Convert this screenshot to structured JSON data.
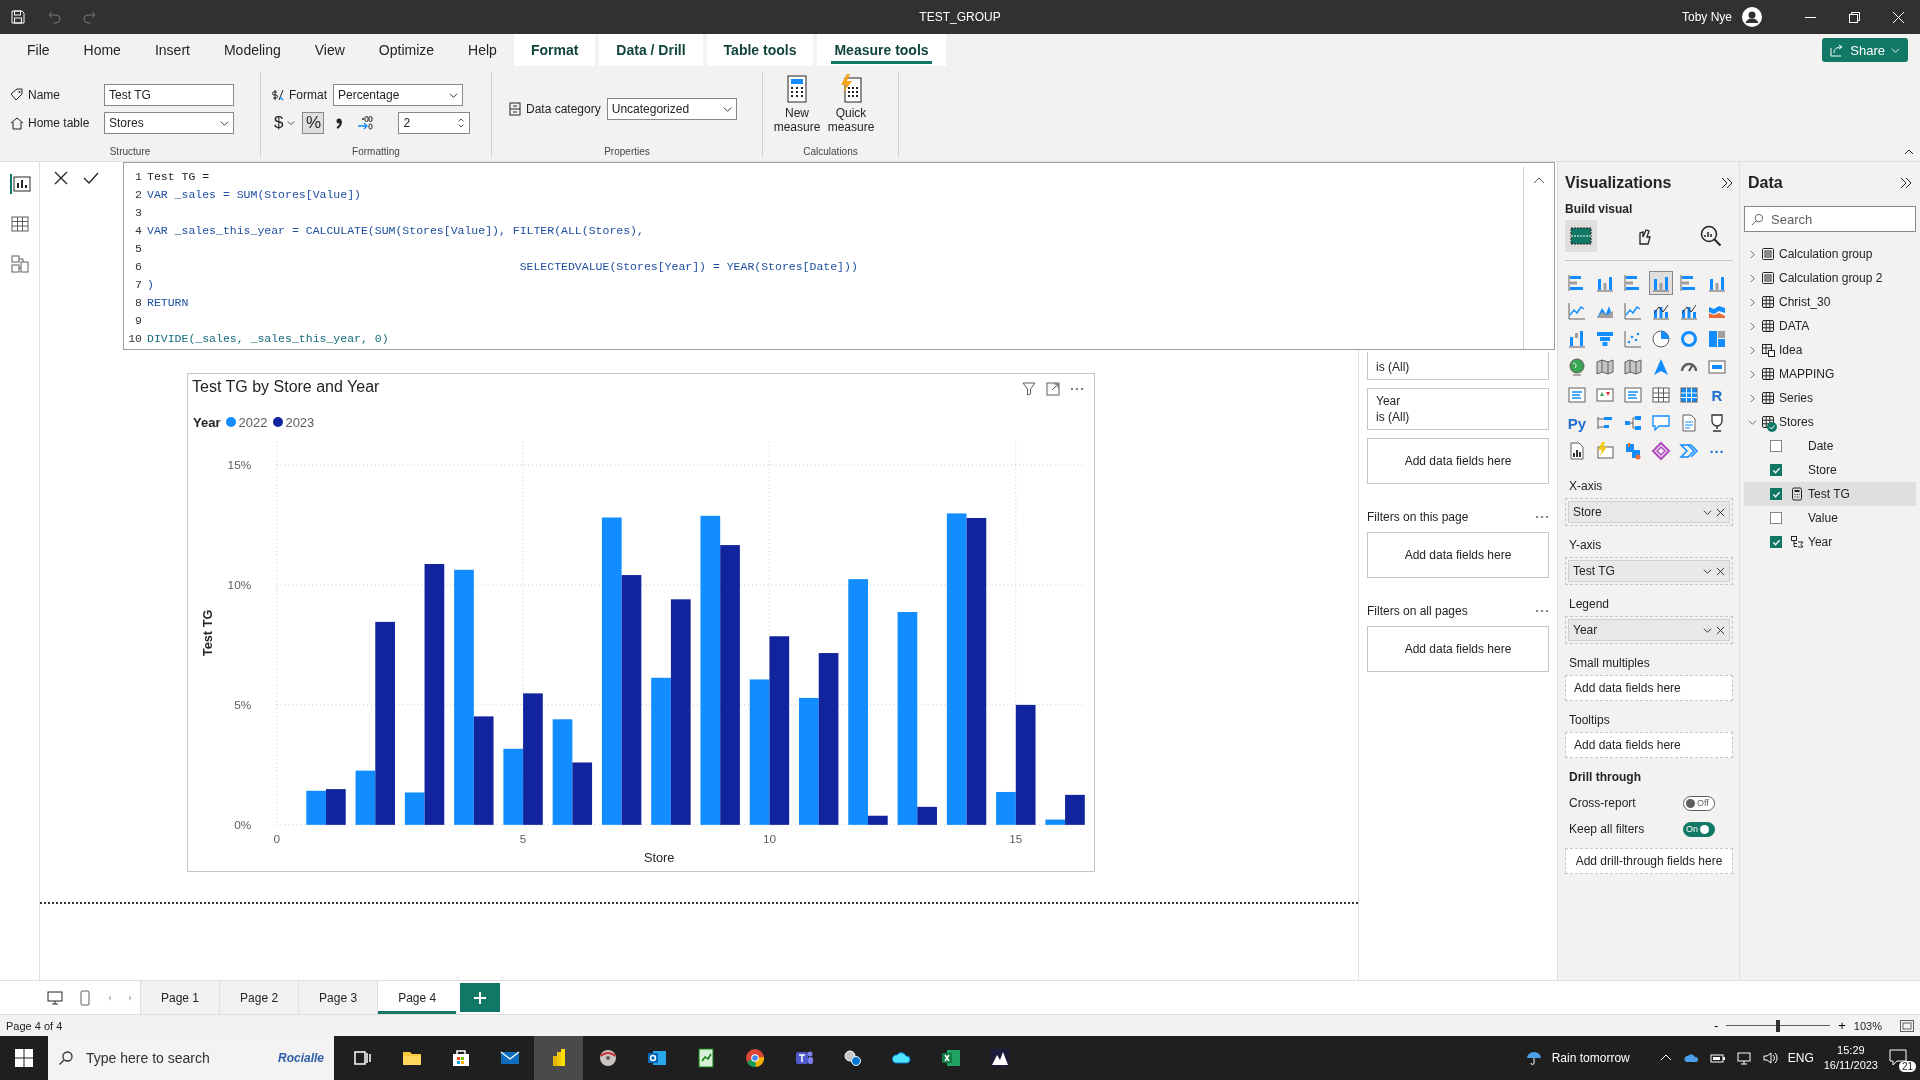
{
  "title_bar": {
    "title": "TEST_GROUP",
    "user": "Toby Nye",
    "quick_access": [
      {
        "kind": "save",
        "disabled": false
      },
      {
        "kind": "undo",
        "disabled": true
      },
      {
        "kind": "redo",
        "disabled": true
      }
    ]
  },
  "ribbon_tabs": [
    {
      "label": "File",
      "kind": "standard",
      "selected": false
    },
    {
      "label": "Home",
      "kind": "standard",
      "selected": false
    },
    {
      "label": "Insert",
      "kind": "standard",
      "selected": false
    },
    {
      "label": "Modeling",
      "kind": "standard",
      "selected": false
    },
    {
      "label": "View",
      "kind": "standard",
      "selected": false
    },
    {
      "label": "Optimize",
      "kind": "standard",
      "selected": false
    },
    {
      "label": "Help",
      "kind": "standard",
      "selected": false
    },
    {
      "label": "Format",
      "kind": "contextual",
      "selected": false
    },
    {
      "label": "Data / Drill",
      "kind": "contextual",
      "selected": false
    },
    {
      "label": "Table tools",
      "kind": "contextual",
      "selected": false
    },
    {
      "label": "Measure tools",
      "kind": "contextual",
      "selected": true
    }
  ],
  "share_button": "Share",
  "ribbon": {
    "name_label": "Name",
    "name_value": "Test TG",
    "home_table_label": "Home table",
    "home_table_value": "Stores",
    "structure_label": "Structure",
    "format_label": "Format",
    "format_value": "Percentage",
    "format_buttons": [
      {
        "kind": "currency",
        "label": "$",
        "selected": false
      },
      {
        "kind": "percent",
        "label": "%",
        "selected": true
      },
      {
        "kind": "comma",
        "selected": false
      },
      {
        "kind": "decimal",
        "selected": false
      }
    ],
    "decimal_places": "2",
    "formatting_label": "Formatting",
    "data_category_label": "Data category",
    "data_category_value": "Uncategorized",
    "properties_label": "Properties",
    "calc_buttons": [
      {
        "kind": "new",
        "label": "New measure"
      },
      {
        "kind": "quick",
        "label": "Quick measure"
      }
    ],
    "calculations_label": "Calculations"
  },
  "formula_bar": {
    "lines": [
      {
        "number": "1",
        "text": "Test TG =",
        "kind": "plain"
      },
      {
        "number": "2",
        "text": "VAR _sales = SUM(Stores[Value])",
        "kind": "code"
      },
      {
        "number": "3"
      },
      {
        "number": "4",
        "text": "VAR _sales_this_year = CALCULATE(SUM(Stores[Value]), FILTER(ALL(Stores),",
        "kind": "code"
      },
      {
        "number": "5"
      },
      {
        "number": "6",
        "text": "                                                      SELECTEDVALUE(Stores[Year]) = YEAR(Stores[Date]))",
        "kind": "code"
      },
      {
        "number": "7",
        "text": ")",
        "kind": "code"
      },
      {
        "number": "8",
        "text": "RETURN",
        "kind": "code"
      },
      {
        "number": "9"
      },
      {
        "number": "10",
        "text": "DIVIDE(_sales, _sales_this_year, 0)",
        "kind": "variable"
      }
    ]
  },
  "visual": {
    "title": "Test TG by Store and Year",
    "legend_title": "Year",
    "chart_data": {
      "type": "bar",
      "xlabel": "Store",
      "ylabel": "Test TG",
      "x": [
        1,
        2,
        3,
        4,
        5,
        6,
        7,
        8,
        9,
        10,
        11,
        12,
        13,
        14,
        15,
        16
      ],
      "series": [
        {
          "name": "2022",
          "color": "#118dff",
          "values": [
            1.42,
            2.26,
            1.35,
            10.63,
            3.17,
            4.4,
            12.81,
            6.13,
            12.88,
            6.06,
            5.29,
            10.24,
            8.87,
            12.98,
            1.37,
            0.22
          ]
        },
        {
          "name": "2023",
          "color": "#12239e",
          "values": [
            1.49,
            8.46,
            10.87,
            4.52,
            5.48,
            2.6,
            10.41,
            9.4,
            11.66,
            7.86,
            7.16,
            0.38,
            0.75,
            12.79,
            5.0,
            1.25
          ]
        }
      ],
      "grid": true,
      "xlim": [
        0,
        16.4
      ],
      "ylim": [
        0,
        16
      ],
      "xticks": [
        0,
        5,
        10,
        15
      ],
      "yticks": [
        {
          "value": 0,
          "label": "0%"
        },
        {
          "value": 5,
          "label": "5%"
        },
        {
          "value": 10,
          "label": "10%"
        },
        {
          "value": 15,
          "label": "15%"
        }
      ]
    }
  },
  "filters": {
    "cards": [
      {
        "value": "is (All)"
      },
      {
        "field": "Year",
        "value": "is (All)"
      }
    ],
    "add_fields": "Add data fields here",
    "sections": [
      {
        "title": "Filters on this page",
        "add_fields": "Add data fields here"
      },
      {
        "title": "Filters on all pages",
        "add_fields": "Add data fields here"
      }
    ]
  },
  "visualizations": {
    "title": "Visualizations",
    "build_label": "Build visual",
    "modes": [
      {
        "kind": "build",
        "selected": true
      },
      {
        "kind": "format",
        "selected": false
      },
      {
        "kind": "analytics",
        "selected": false
      }
    ],
    "gallery": [
      {
        "kind": "hbar",
        "selected": false
      },
      {
        "kind": "col",
        "selected": false
      },
      {
        "kind": "hbar",
        "selected": false
      },
      {
        "kind": "col",
        "selected": true
      },
      {
        "kind": "hbar",
        "selected": false
      },
      {
        "kind": "col",
        "selected": false
      },
      {
        "kind": "line",
        "selected": false
      },
      {
        "kind": "area",
        "selected": false
      },
      {
        "kind": "line",
        "selected": false
      },
      {
        "kind": "combo",
        "selected": false
      },
      {
        "kind": "combo",
        "selected": false
      },
      {
        "kind": "ribbon",
        "selected": false
      },
      {
        "kind": "waterfall",
        "selected": false
      },
      {
        "kind": "funnel",
        "selected": false
      },
      {
        "kind": "scatter",
        "selected": false
      },
      {
        "kind": "pie",
        "selected": false
      },
      {
        "kind": "donut",
        "selected": false
      },
      {
        "kind": "treemap",
        "selected": false
      },
      {
        "kind": "globe",
        "selected": false
      },
      {
        "kind": "map",
        "selected": false
      },
      {
        "kind": "map",
        "selected": false
      },
      {
        "kind": "arrow",
        "selected": false
      },
      {
        "kind": "gauge",
        "selected": false
      },
      {
        "kind": "card",
        "selected": false
      },
      {
        "kind": "slicer",
        "selected": false
      },
      {
        "kind": "kpi",
        "selected": false
      },
      {
        "kind": "slicer",
        "selected": false
      },
      {
        "kind": "table",
        "selected": false
      },
      {
        "kind": "matrix",
        "selected": false
      },
      {
        "kind": "text",
        "label": "R",
        "selected": false
      },
      {
        "kind": "text",
        "label": "Py",
        "selected": false
      },
      {
        "kind": "decomp",
        "selected": false
      },
      {
        "kind": "tree",
        "selected": false
      },
      {
        "kind": "chat",
        "selected": false
      },
      {
        "kind": "document",
        "selected": false
      },
      {
        "kind": "trophy",
        "selected": false
      },
      {
        "kind": "report",
        "selected": false
      },
      {
        "kind": "lightning",
        "selected": false
      },
      {
        "kind": "apps",
        "selected": false
      },
      {
        "kind": "diamond",
        "selected": false
      },
      {
        "kind": "chevron",
        "selected": false
      },
      {
        "kind": "text",
        "label": "···",
        "selected": false
      }
    ],
    "wells": [
      {
        "label": "X-axis",
        "field": "Store"
      },
      {
        "label": "Y-axis",
        "field": "Test TG"
      },
      {
        "label": "Legend",
        "field": "Year"
      },
      {
        "label": "Small multiples",
        "empty_text": "Add data fields here"
      },
      {
        "label": "Tooltips",
        "empty_text": "Add data fields here"
      }
    ],
    "drill_title": "Drill through",
    "toggles": [
      {
        "label": "Cross-report",
        "on": false,
        "state_text": "Off"
      },
      {
        "label": "Keep all filters",
        "on": true,
        "state_text": "On"
      }
    ],
    "drill_empty_text": "Add drill-through fields here"
  },
  "data_pane": {
    "title": "Data",
    "search_placeholder": "Search",
    "tables": [
      {
        "name": "Calculation group",
        "kind": "calc",
        "expanded": false,
        "in_use": false
      },
      {
        "name": "Calculation group 2",
        "kind": "calc",
        "expanded": false,
        "in_use": false
      },
      {
        "name": "Christ_30",
        "kind": "table",
        "expanded": false,
        "in_use": false
      },
      {
        "name": "DATA",
        "kind": "table",
        "expanded": false,
        "in_use": false
      },
      {
        "name": "Idea",
        "kind": "calc_table",
        "expanded": false,
        "in_use": false
      },
      {
        "name": "MAPPING",
        "kind": "table",
        "expanded": false,
        "in_use": false
      },
      {
        "name": "Series",
        "kind": "table",
        "expanded": false,
        "in_use": false
      },
      {
        "name": "Stores",
        "kind": "table",
        "expanded": true,
        "in_use": true,
        "children": [
          {
            "name": "Date",
            "kind": "column",
            "checked": false,
            "selected": false
          },
          {
            "name": "Store",
            "kind": "column",
            "checked": true,
            "selected": false
          },
          {
            "name": "Test TG",
            "kind": "measure",
            "checked": true,
            "selected": true
          },
          {
            "name": "Value",
            "kind": "column",
            "checked": false,
            "selected": false
          },
          {
            "name": "Year",
            "kind": "hierarchy",
            "checked": true,
            "selected": false
          }
        ]
      }
    ]
  },
  "page_tabs": [
    {
      "label": "Page 1",
      "selected": false
    },
    {
      "label": "Page 2",
      "selected": false
    },
    {
      "label": "Page 3",
      "selected": false
    },
    {
      "label": "Page 4",
      "selected": true
    }
  ],
  "status_bar": {
    "page": "Page 4 of 4",
    "zoom_out": "-",
    "zoom_in": "+",
    "zoom": "103%",
    "level": 0.5
  },
  "taskbar": {
    "search_placeholder": "Type here to search",
    "search_badge": "Rocialle",
    "apps": [
      {
        "kind": "taskview",
        "selected": false
      },
      {
        "kind": "folder",
        "selected": false
      },
      {
        "kind": "bag",
        "selected": false
      },
      {
        "kind": "mail",
        "selected": false
      },
      {
        "kind": "powerbi",
        "selected": true
      },
      {
        "kind": "disc",
        "selected": false
      },
      {
        "kind": "outlook",
        "selected": false
      },
      {
        "kind": "notepad",
        "selected": false
      },
      {
        "kind": "chrome",
        "selected": false
      },
      {
        "kind": "teams",
        "selected": false
      },
      {
        "kind": "gears",
        "selected": false
      },
      {
        "kind": "cloud",
        "selected": false
      },
      {
        "kind": "excel",
        "selected": false
      },
      {
        "kind": "mountain",
        "selected": false
      }
    ],
    "weather": "Rain tomorrow",
    "language": "ENG",
    "time": "15:29",
    "date": "16/11/2023",
    "notifications": "21"
  }
}
